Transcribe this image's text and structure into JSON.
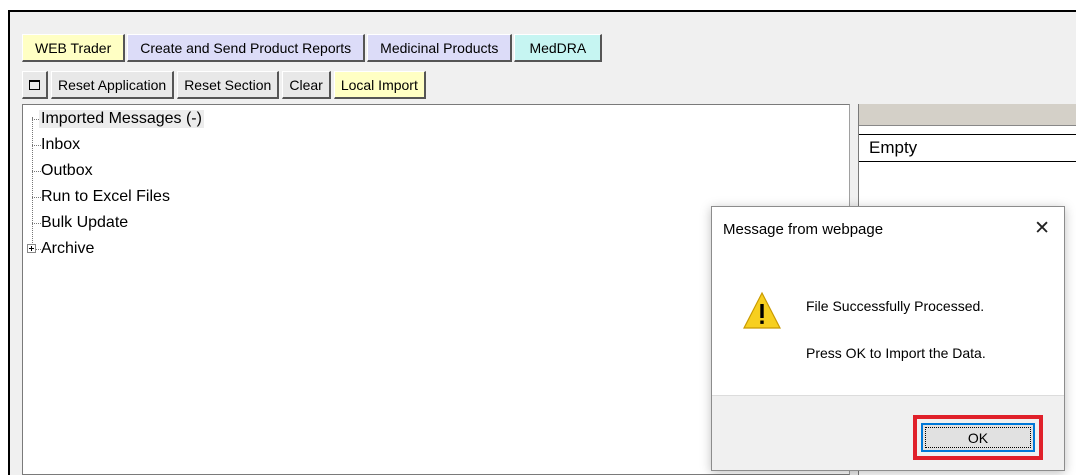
{
  "tabs": [
    {
      "label": "WEB Trader",
      "color": "#ffffc4"
    },
    {
      "label": "Create and Send Product Reports",
      "color": "#dcdcf8"
    },
    {
      "label": "Medicinal Products",
      "color": "#dcdcf8"
    },
    {
      "label": "MedDRA",
      "color": "#c6f5f2"
    }
  ],
  "toolbar": {
    "toggle_icon": "window-square-icon",
    "reset_application": "Reset Application",
    "reset_section": "Reset Section",
    "clear": "Clear",
    "local_import": "Local Import",
    "local_import_color": "#ffffc4"
  },
  "tree": {
    "items": [
      {
        "label": "Imported Messages (-)",
        "selected": true
      },
      {
        "label": "Inbox"
      },
      {
        "label": "Outbox"
      },
      {
        "label": "Run to Excel Files"
      },
      {
        "label": "Bulk Update"
      },
      {
        "label": "Archive",
        "expandable": true
      }
    ]
  },
  "right_panel": {
    "title": "Empty"
  },
  "dialog": {
    "title": "Message from webpage",
    "icon": "warning-icon",
    "message_line1": "File Successfully Processed.",
    "message_line2": "Press OK to Import the Data.",
    "ok_label": "OK",
    "highlight_color": "#e0202a"
  }
}
